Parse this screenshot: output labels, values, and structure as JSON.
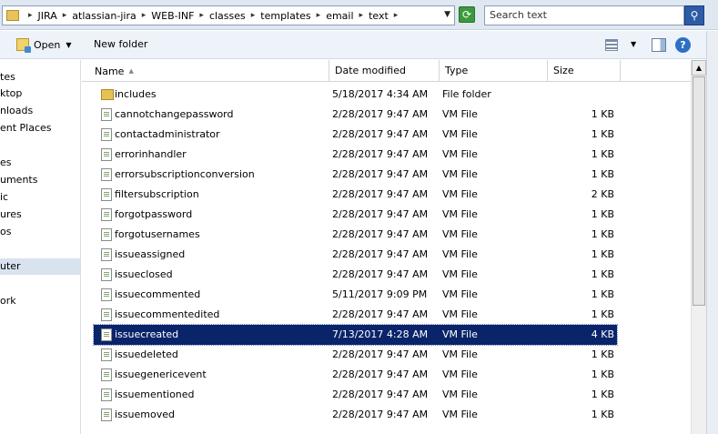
{
  "address": {
    "crumbs": [
      "JIRA",
      "atlassian-jira",
      "WEB-INF",
      "classes",
      "templates",
      "email",
      "text"
    ],
    "separator": "▸",
    "dropdown_glyph": "▼"
  },
  "search": {
    "placeholder": "Search text"
  },
  "toolbar": {
    "open_label": "Open",
    "open_caret": "▼",
    "new_folder_label": "New folder",
    "view_caret": "▼",
    "help_glyph": "?"
  },
  "nav": {
    "items": [
      "tes",
      "ktop",
      "nloads",
      "ent Places",
      "es",
      "uments",
      "ic",
      "ures",
      "os",
      "uter",
      "ork"
    ]
  },
  "columns": {
    "name": "Name",
    "date": "Date modified",
    "type": "Type",
    "size": "Size",
    "sort_arrow": "▲"
  },
  "files": [
    {
      "name": "includes",
      "date": "5/18/2017 4:34 AM",
      "type": "File folder",
      "size": "",
      "icon": "folder-icon"
    },
    {
      "name": "cannotchangepassword",
      "date": "2/28/2017 9:47 AM",
      "type": "VM File",
      "size": "1 KB",
      "icon": "file-icon"
    },
    {
      "name": "contactadministrator",
      "date": "2/28/2017 9:47 AM",
      "type": "VM File",
      "size": "1 KB",
      "icon": "file-icon"
    },
    {
      "name": "errorinhandler",
      "date": "2/28/2017 9:47 AM",
      "type": "VM File",
      "size": "1 KB",
      "icon": "file-icon"
    },
    {
      "name": "errorsubscriptionconversion",
      "date": "2/28/2017 9:47 AM",
      "type": "VM File",
      "size": "1 KB",
      "icon": "file-icon"
    },
    {
      "name": "filtersubscription",
      "date": "2/28/2017 9:47 AM",
      "type": "VM File",
      "size": "2 KB",
      "icon": "file-icon"
    },
    {
      "name": "forgotpassword",
      "date": "2/28/2017 9:47 AM",
      "type": "VM File",
      "size": "1 KB",
      "icon": "file-icon"
    },
    {
      "name": "forgotusernames",
      "date": "2/28/2017 9:47 AM",
      "type": "VM File",
      "size": "1 KB",
      "icon": "file-icon"
    },
    {
      "name": "issueassigned",
      "date": "2/28/2017 9:47 AM",
      "type": "VM File",
      "size": "1 KB",
      "icon": "file-icon"
    },
    {
      "name": "issueclosed",
      "date": "2/28/2017 9:47 AM",
      "type": "VM File",
      "size": "1 KB",
      "icon": "file-icon"
    },
    {
      "name": "issuecommented",
      "date": "5/11/2017 9:09 PM",
      "type": "VM File",
      "size": "1 KB",
      "icon": "file-icon"
    },
    {
      "name": "issuecommentedited",
      "date": "2/28/2017 9:47 AM",
      "type": "VM File",
      "size": "1 KB",
      "icon": "file-icon"
    },
    {
      "name": "issuecreated",
      "date": "7/13/2017 4:28 AM",
      "type": "VM File",
      "size": "4 KB",
      "icon": "file-icon",
      "selected": true
    },
    {
      "name": "issuedeleted",
      "date": "2/28/2017 9:47 AM",
      "type": "VM File",
      "size": "1 KB",
      "icon": "file-icon"
    },
    {
      "name": "issuegenericevent",
      "date": "2/28/2017 9:47 AM",
      "type": "VM File",
      "size": "1 KB",
      "icon": "file-icon"
    },
    {
      "name": "issuementioned",
      "date": "2/28/2017 9:47 AM",
      "type": "VM File",
      "size": "1 KB",
      "icon": "file-icon"
    },
    {
      "name": "issuemoved",
      "date": "2/28/2017 9:47 AM",
      "type": "VM File",
      "size": "1 KB",
      "icon": "file-icon"
    }
  ],
  "colors": {
    "selection": "#0a246a",
    "address_bg": "#dfe7f1",
    "toolbar_bg": "#eef3fa"
  }
}
